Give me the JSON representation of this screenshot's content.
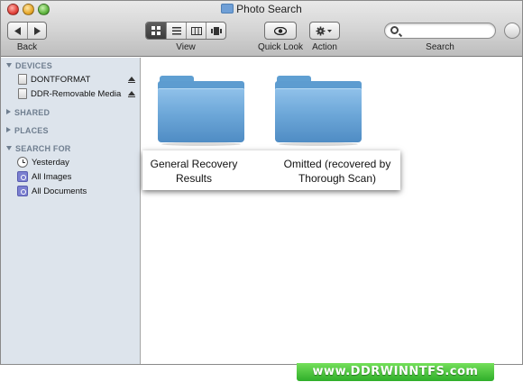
{
  "window": {
    "title": "Photo Search"
  },
  "toolbar": {
    "back_label": "Back",
    "view_label": "View",
    "quick_look_label": "Quick Look",
    "action_label": "Action",
    "search_label": "Search",
    "search_placeholder": "",
    "view_modes": [
      "icon-view",
      "list-view",
      "column-view",
      "cover-flow-view"
    ],
    "active_view_mode": "icon-view"
  },
  "sidebar": {
    "devices": {
      "header": "DEVICES",
      "items": [
        {
          "label": "DONTFORMAT",
          "icon": "disk-icon",
          "eject": true
        },
        {
          "label": "DDR-Removable Media",
          "icon": "disk-icon",
          "eject": true
        }
      ]
    },
    "shared": {
      "header": "SHARED"
    },
    "places": {
      "header": "PLACES"
    },
    "search_for": {
      "header": "SEARCH FOR",
      "items": [
        {
          "label": "Yesterday",
          "icon": "clock-icon"
        },
        {
          "label": "All Images",
          "icon": "smart-folder-icon"
        },
        {
          "label": "All Documents",
          "icon": "smart-folder-icon"
        }
      ]
    }
  },
  "content": {
    "folders": [
      {
        "label_line1": "General Recovery",
        "label_line2": "Results"
      },
      {
        "label_line1": "Omitted (recovered by",
        "label_line2": "Thorough Scan)"
      }
    ]
  },
  "watermark": {
    "text": "www.DDRWINNTFS.com"
  },
  "colors": {
    "sidebar_bg": "#dde4ec",
    "folder_blue": "#6ea8d9",
    "watermark_green": "#3cba30"
  }
}
